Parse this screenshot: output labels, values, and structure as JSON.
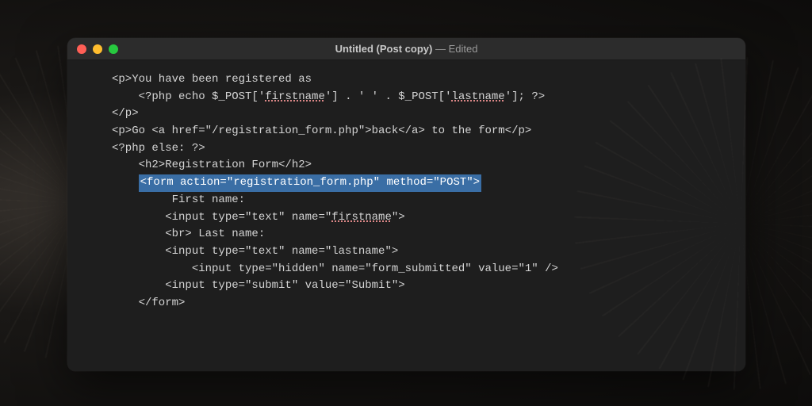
{
  "window": {
    "title_main": "Untitled (Post copy)",
    "title_suffix": " — Edited"
  },
  "code": {
    "l1": "<p>You have been registered as",
    "l2a": "    <?php echo $_POST['",
    "l2b": "firstname",
    "l2c": "'] . ' ' . $_POST['",
    "l2d": "lastname",
    "l2e": "']; ?>",
    "l3": "</p>",
    "l4": "",
    "l5": "<p>Go <a href=\"/registration_form.php\">back</a> to the form</p>",
    "l6": "",
    "l7": "<?php else: ?>",
    "l8": "",
    "l9": "    <h2>Registration Form</h2>",
    "l10": "",
    "l11_pad": "    ",
    "l11": "<form action=\"registration_form.php\" method=\"POST\">",
    "l12": "",
    "l13": "         First name:",
    "l14a": "        <input type=\"text\" name=\"",
    "l14b": "firstname",
    "l14c": "\">",
    "l15": "",
    "l16": "        <br> Last name:",
    "l17": "        <input type=\"text\" name=\"lastname\">",
    "l18": "",
    "l19": "            <input type=\"hidden\" name=\"form_submitted\" value=\"1\" />",
    "l20": "",
    "l21": "        <input type=\"submit\" value=\"Submit\">",
    "l22": "",
    "l23": "    </form>"
  }
}
